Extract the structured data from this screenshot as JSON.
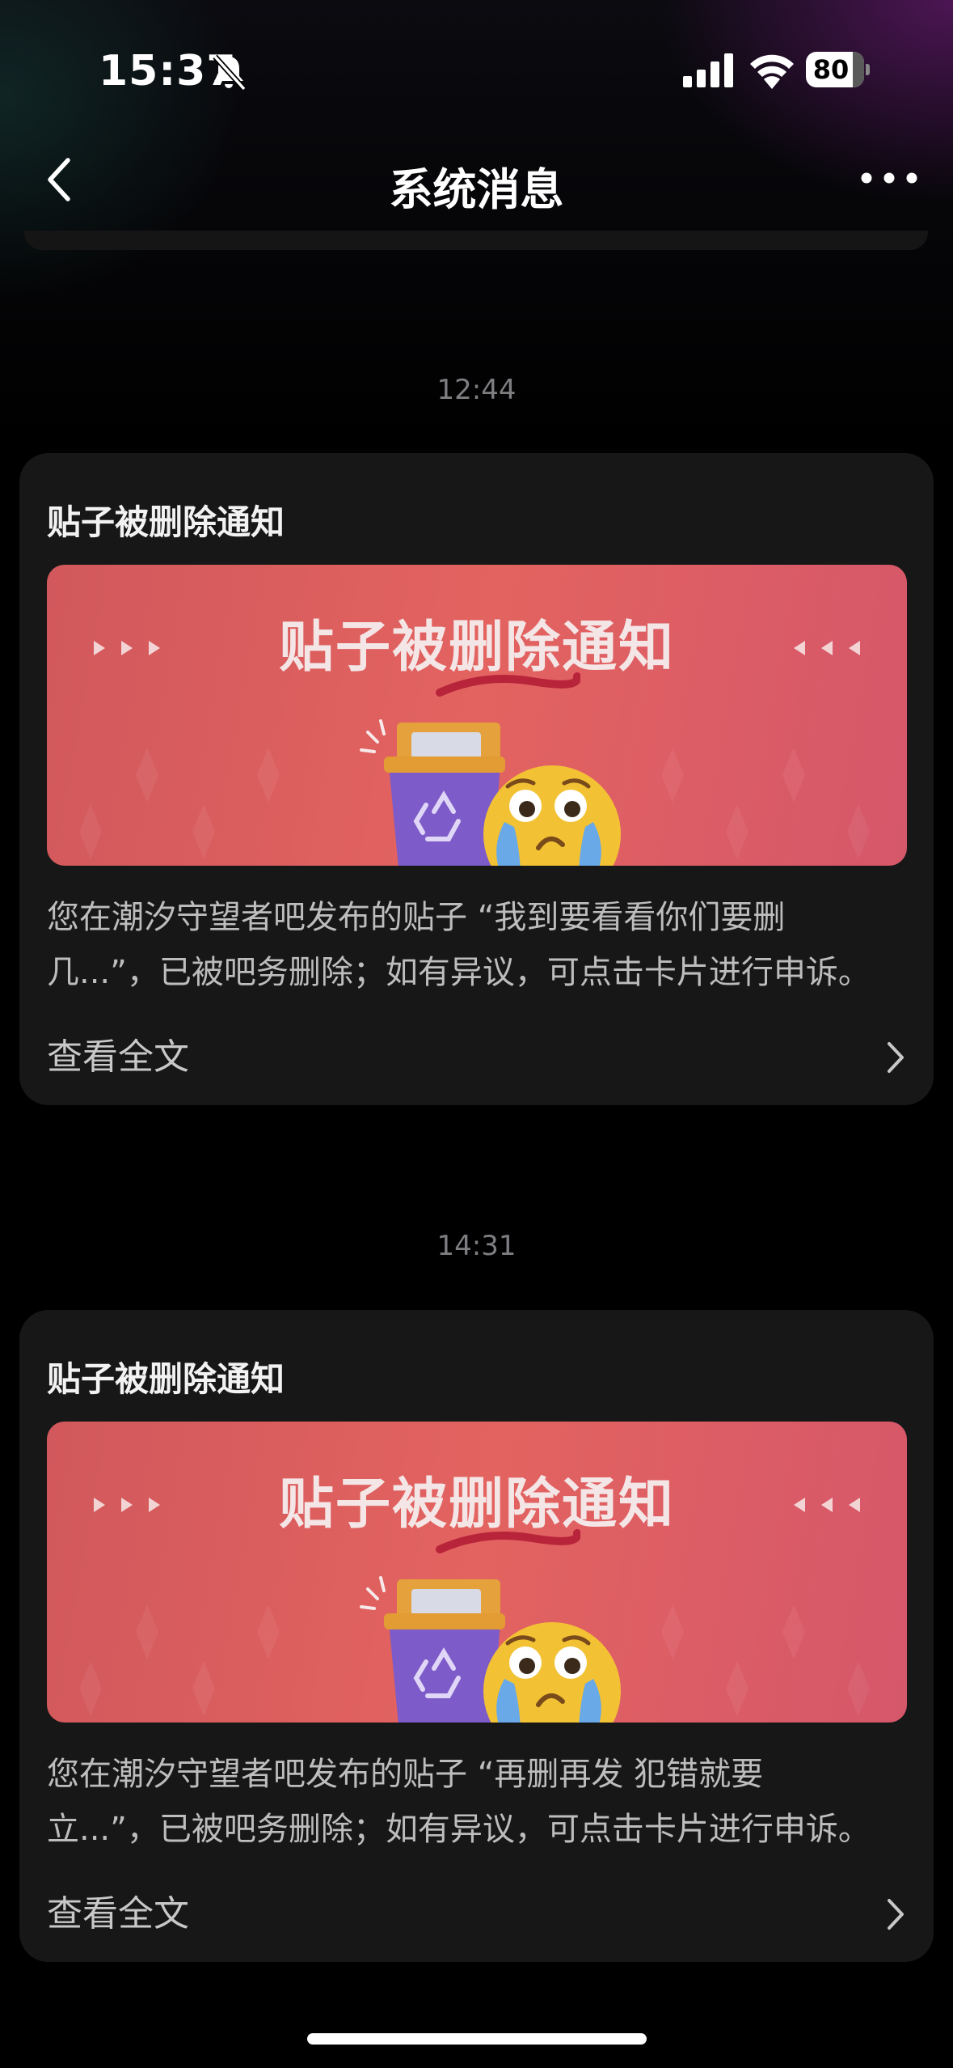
{
  "status_bar": {
    "time": "15:37",
    "battery": "80",
    "battery_level": 0.8,
    "icons": [
      "bell-off-icon",
      "cellular-signal-icon",
      "wifi-icon",
      "battery-icon"
    ]
  },
  "nav": {
    "title": "系统消息",
    "back_icon": "chevron-left-icon",
    "more_icon": "more-dots-icon"
  },
  "messages": [
    {
      "time": "12:44",
      "title": "贴子被删除通知",
      "banner_title": "贴子被删除通知",
      "body_line1": "您在潮汐守望者吧发布的贴子 “我到要看看你们要删",
      "body_line2": "几...”，已被吧务删除；如有异议，可点击卡片进行申诉。",
      "link_label": "查看全文"
    },
    {
      "time": "14:31",
      "title": "贴子被删除通知",
      "banner_title": "贴子被删除通知",
      "body_line1": "您在潮汐守望者吧发布的贴子 “再删再发 犯错就要",
      "body_line2": "立...”，已被吧务删除；如有异议，可点击卡片进行申诉。",
      "link_label": "查看全文"
    }
  ],
  "colors": {
    "background": "#000000",
    "card": "#171717",
    "banner_red": "#e06060",
    "timestamp": "#7e7e82"
  }
}
